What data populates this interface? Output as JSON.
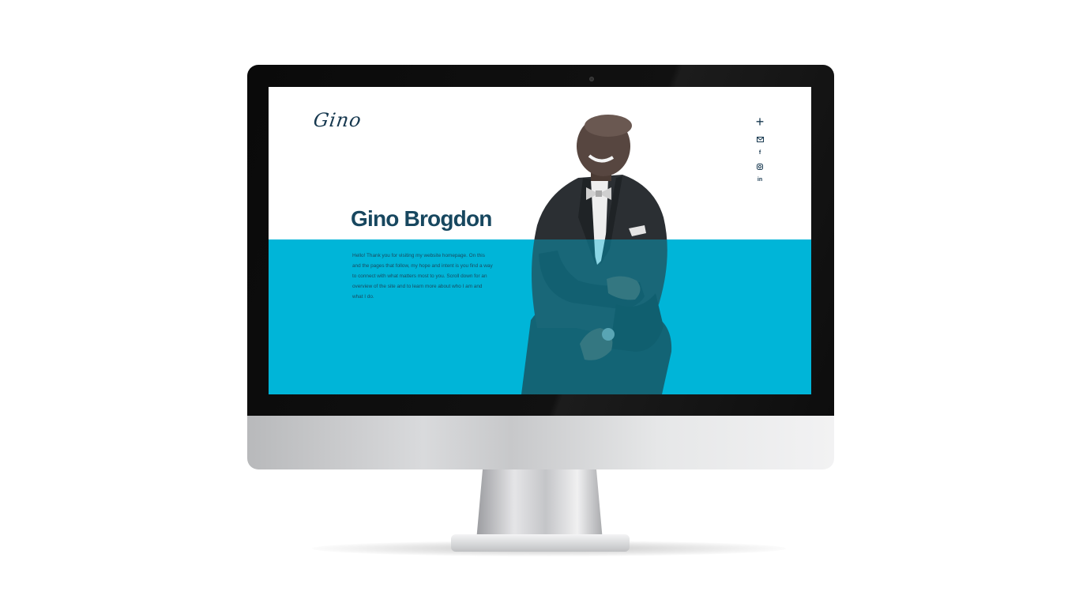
{
  "site": {
    "logo_text": "Gino",
    "hero_title": "Gino Brogdon",
    "intro_text": "Hello! Thank you for visiting my website homepage. On this and the pages that follow, my hope and intent is you find a way to connect with what matters most to you. Scroll down for an overview of the site and to learn more about who I am and what I do.",
    "menu_toggle": "+",
    "social_icons": [
      "email-icon",
      "facebook-icon",
      "instagram-icon",
      "linkedin-icon"
    ],
    "facebook_glyph": "f",
    "linkedin_glyph": "in"
  },
  "colors": {
    "accent_cyan": "#00b5d8",
    "navy_text": "#17475f",
    "bezel": "#0a0a0a",
    "aluminum": "#d9dadc"
  }
}
